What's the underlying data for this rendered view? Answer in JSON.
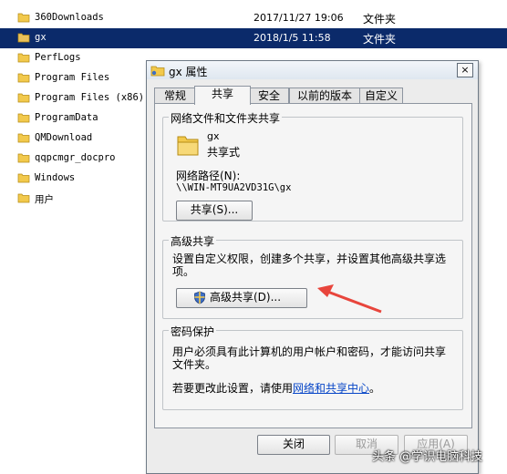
{
  "files": [
    {
      "name": "360Downloads",
      "date": "2017/11/27 19:06",
      "type": "文件夹",
      "selected": false
    },
    {
      "name": "gx",
      "date": "2018/1/5 11:58",
      "type": "文件夹",
      "selected": true
    },
    {
      "name": "PerfLogs",
      "date": "",
      "type": "",
      "selected": false
    },
    {
      "name": "Program Files",
      "date": "",
      "type": "",
      "selected": false
    },
    {
      "name": "Program Files (x86)",
      "date": "",
      "type": "",
      "selected": false
    },
    {
      "name": "ProgramData",
      "date": "",
      "type": "",
      "selected": false
    },
    {
      "name": "QMDownload",
      "date": "",
      "type": "",
      "selected": false
    },
    {
      "name": "qqpcmgr_docpro",
      "date": "",
      "type": "",
      "selected": false
    },
    {
      "name": "Windows",
      "date": "",
      "type": "",
      "selected": false
    },
    {
      "name": "用户",
      "date": "",
      "type": "",
      "selected": false
    }
  ],
  "dialog": {
    "title": "gx 属性",
    "close_glyph": "×",
    "tabs": [
      "常规",
      "共享",
      "安全",
      "以前的版本",
      "自定义"
    ],
    "active_tab": "共享",
    "network_section": {
      "label": "网络文件和文件夹共享",
      "folder_name": "gx",
      "status": "共享式",
      "path_label": "网络路径(N):",
      "path": "\\\\WIN-MT9UA2VD31G\\gx",
      "share_button": "共享(S)..."
    },
    "advanced_section": {
      "label": "高级共享",
      "desc_line1": "设置自定义权限，创建多个共享，并设置其他高级共享选",
      "desc_line2": "项。",
      "button": "高级共享(D)..."
    },
    "password_section": {
      "label": "密码保护",
      "desc_line1": "用户必须具有此计算机的用户帐户和密码，才能访问共享",
      "desc_line2": "文件夹。",
      "change_prefix": "若要更改此设置，请使用",
      "link": "网络和共享中心",
      "change_suffix": "。"
    },
    "buttons": {
      "close": "关闭",
      "cancel": "取消",
      "apply": "应用(A)"
    }
  },
  "watermark": "头条 @学识电脑科技",
  "colors": {
    "selection": "#0b2a6a",
    "folder": "#f2c94c",
    "arrow": "#e8453c",
    "link": "#0645c7"
  }
}
